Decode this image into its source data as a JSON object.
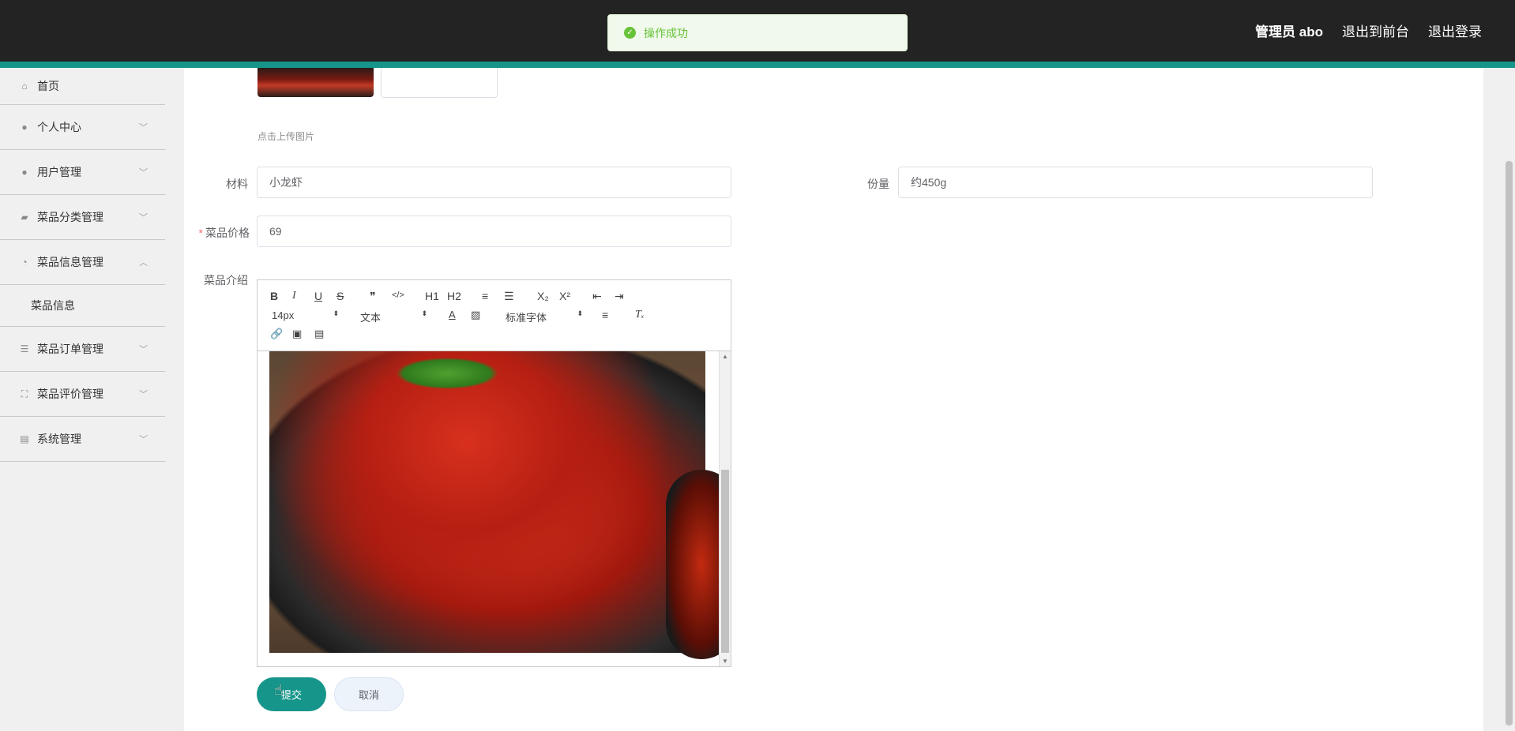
{
  "header": {
    "admin_label": "管理员 abo",
    "front_link": "退出到前台",
    "logout_link": "退出登录"
  },
  "toast": {
    "message": "操作成功"
  },
  "sidebar": {
    "items": [
      {
        "label": "首页",
        "icon": "home-icon"
      },
      {
        "label": "个人中心",
        "icon": "user-icon"
      },
      {
        "label": "用户管理",
        "icon": "user-icon"
      },
      {
        "label": "菜品分类管理",
        "icon": "suitcase-icon"
      },
      {
        "label": "菜品信息管理",
        "icon": "gauge-icon"
      },
      {
        "label": "菜品订单管理",
        "icon": "sliders-icon"
      },
      {
        "label": "菜品评价管理",
        "icon": "fullscreen-icon"
      },
      {
        "label": "系统管理",
        "icon": "chart-icon"
      }
    ],
    "active_sub": "菜品信息"
  },
  "form": {
    "upload_tip": "点击上传图片",
    "material_label": "材料",
    "material_value": "小龙虾",
    "portion_label": "份量",
    "portion_value": "约450g",
    "price_label": "菜品价格",
    "price_value": "69",
    "intro_label": "菜品介绍"
  },
  "editor": {
    "font_size": "14px",
    "header_select": "文本",
    "font_family": "标准字体",
    "tools_row1": [
      "B",
      "I",
      "U",
      "S",
      "❞",
      "</>",
      "H1",
      "H2",
      "≡",
      "☰",
      "X₂",
      "X²",
      "⇤",
      "⇥"
    ]
  },
  "buttons": {
    "submit": "提交",
    "cancel": "取消"
  }
}
